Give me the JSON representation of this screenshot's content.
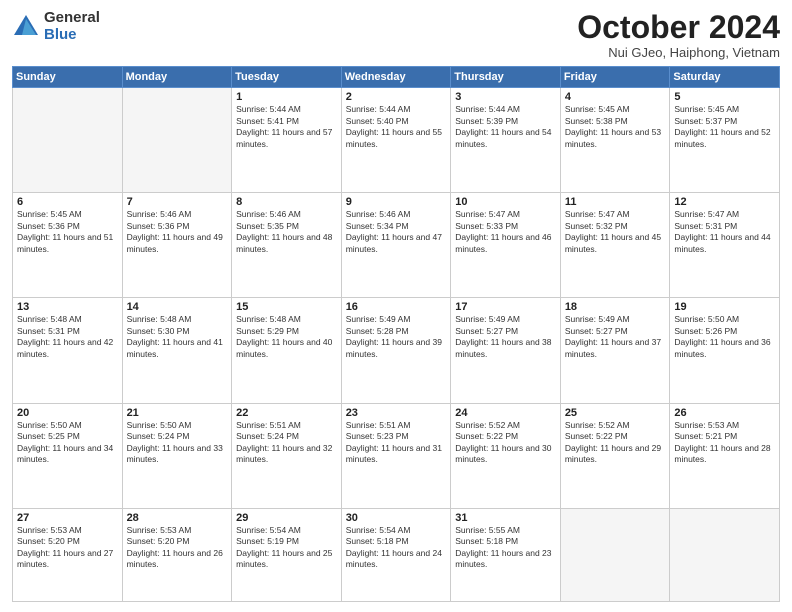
{
  "logo": {
    "general": "General",
    "blue": "Blue"
  },
  "header": {
    "month": "October 2024",
    "location": "Nui GJeo, Haiphong, Vietnam"
  },
  "weekdays": [
    "Sunday",
    "Monday",
    "Tuesday",
    "Wednesday",
    "Thursday",
    "Friday",
    "Saturday"
  ],
  "weeks": [
    [
      {
        "day": null
      },
      {
        "day": null
      },
      {
        "day": "1",
        "sunrise": "Sunrise: 5:44 AM",
        "sunset": "Sunset: 5:41 PM",
        "daylight": "Daylight: 11 hours and 57 minutes."
      },
      {
        "day": "2",
        "sunrise": "Sunrise: 5:44 AM",
        "sunset": "Sunset: 5:40 PM",
        "daylight": "Daylight: 11 hours and 55 minutes."
      },
      {
        "day": "3",
        "sunrise": "Sunrise: 5:44 AM",
        "sunset": "Sunset: 5:39 PM",
        "daylight": "Daylight: 11 hours and 54 minutes."
      },
      {
        "day": "4",
        "sunrise": "Sunrise: 5:45 AM",
        "sunset": "Sunset: 5:38 PM",
        "daylight": "Daylight: 11 hours and 53 minutes."
      },
      {
        "day": "5",
        "sunrise": "Sunrise: 5:45 AM",
        "sunset": "Sunset: 5:37 PM",
        "daylight": "Daylight: 11 hours and 52 minutes."
      }
    ],
    [
      {
        "day": "6",
        "sunrise": "Sunrise: 5:45 AM",
        "sunset": "Sunset: 5:36 PM",
        "daylight": "Daylight: 11 hours and 51 minutes."
      },
      {
        "day": "7",
        "sunrise": "Sunrise: 5:46 AM",
        "sunset": "Sunset: 5:36 PM",
        "daylight": "Daylight: 11 hours and 49 minutes."
      },
      {
        "day": "8",
        "sunrise": "Sunrise: 5:46 AM",
        "sunset": "Sunset: 5:35 PM",
        "daylight": "Daylight: 11 hours and 48 minutes."
      },
      {
        "day": "9",
        "sunrise": "Sunrise: 5:46 AM",
        "sunset": "Sunset: 5:34 PM",
        "daylight": "Daylight: 11 hours and 47 minutes."
      },
      {
        "day": "10",
        "sunrise": "Sunrise: 5:47 AM",
        "sunset": "Sunset: 5:33 PM",
        "daylight": "Daylight: 11 hours and 46 minutes."
      },
      {
        "day": "11",
        "sunrise": "Sunrise: 5:47 AM",
        "sunset": "Sunset: 5:32 PM",
        "daylight": "Daylight: 11 hours and 45 minutes."
      },
      {
        "day": "12",
        "sunrise": "Sunrise: 5:47 AM",
        "sunset": "Sunset: 5:31 PM",
        "daylight": "Daylight: 11 hours and 44 minutes."
      }
    ],
    [
      {
        "day": "13",
        "sunrise": "Sunrise: 5:48 AM",
        "sunset": "Sunset: 5:31 PM",
        "daylight": "Daylight: 11 hours and 42 minutes."
      },
      {
        "day": "14",
        "sunrise": "Sunrise: 5:48 AM",
        "sunset": "Sunset: 5:30 PM",
        "daylight": "Daylight: 11 hours and 41 minutes."
      },
      {
        "day": "15",
        "sunrise": "Sunrise: 5:48 AM",
        "sunset": "Sunset: 5:29 PM",
        "daylight": "Daylight: 11 hours and 40 minutes."
      },
      {
        "day": "16",
        "sunrise": "Sunrise: 5:49 AM",
        "sunset": "Sunset: 5:28 PM",
        "daylight": "Daylight: 11 hours and 39 minutes."
      },
      {
        "day": "17",
        "sunrise": "Sunrise: 5:49 AM",
        "sunset": "Sunset: 5:27 PM",
        "daylight": "Daylight: 11 hours and 38 minutes."
      },
      {
        "day": "18",
        "sunrise": "Sunrise: 5:49 AM",
        "sunset": "Sunset: 5:27 PM",
        "daylight": "Daylight: 11 hours and 37 minutes."
      },
      {
        "day": "19",
        "sunrise": "Sunrise: 5:50 AM",
        "sunset": "Sunset: 5:26 PM",
        "daylight": "Daylight: 11 hours and 36 minutes."
      }
    ],
    [
      {
        "day": "20",
        "sunrise": "Sunrise: 5:50 AM",
        "sunset": "Sunset: 5:25 PM",
        "daylight": "Daylight: 11 hours and 34 minutes."
      },
      {
        "day": "21",
        "sunrise": "Sunrise: 5:50 AM",
        "sunset": "Sunset: 5:24 PM",
        "daylight": "Daylight: 11 hours and 33 minutes."
      },
      {
        "day": "22",
        "sunrise": "Sunrise: 5:51 AM",
        "sunset": "Sunset: 5:24 PM",
        "daylight": "Daylight: 11 hours and 32 minutes."
      },
      {
        "day": "23",
        "sunrise": "Sunrise: 5:51 AM",
        "sunset": "Sunset: 5:23 PM",
        "daylight": "Daylight: 11 hours and 31 minutes."
      },
      {
        "day": "24",
        "sunrise": "Sunrise: 5:52 AM",
        "sunset": "Sunset: 5:22 PM",
        "daylight": "Daylight: 11 hours and 30 minutes."
      },
      {
        "day": "25",
        "sunrise": "Sunrise: 5:52 AM",
        "sunset": "Sunset: 5:22 PM",
        "daylight": "Daylight: 11 hours and 29 minutes."
      },
      {
        "day": "26",
        "sunrise": "Sunrise: 5:53 AM",
        "sunset": "Sunset: 5:21 PM",
        "daylight": "Daylight: 11 hours and 28 minutes."
      }
    ],
    [
      {
        "day": "27",
        "sunrise": "Sunrise: 5:53 AM",
        "sunset": "Sunset: 5:20 PM",
        "daylight": "Daylight: 11 hours and 27 minutes."
      },
      {
        "day": "28",
        "sunrise": "Sunrise: 5:53 AM",
        "sunset": "Sunset: 5:20 PM",
        "daylight": "Daylight: 11 hours and 26 minutes."
      },
      {
        "day": "29",
        "sunrise": "Sunrise: 5:54 AM",
        "sunset": "Sunset: 5:19 PM",
        "daylight": "Daylight: 11 hours and 25 minutes."
      },
      {
        "day": "30",
        "sunrise": "Sunrise: 5:54 AM",
        "sunset": "Sunset: 5:18 PM",
        "daylight": "Daylight: 11 hours and 24 minutes."
      },
      {
        "day": "31",
        "sunrise": "Sunrise: 5:55 AM",
        "sunset": "Sunset: 5:18 PM",
        "daylight": "Daylight: 11 hours and 23 minutes."
      },
      {
        "day": null
      },
      {
        "day": null
      }
    ]
  ]
}
